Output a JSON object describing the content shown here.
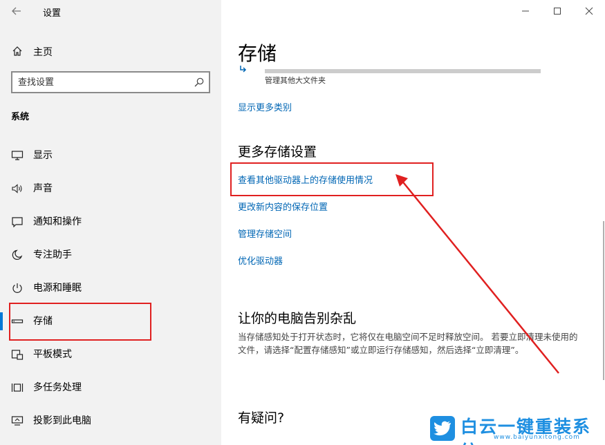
{
  "app": {
    "title": "设置"
  },
  "sidebar": {
    "home_label": "主页",
    "search_placeholder": "查找设置",
    "section_label": "系统",
    "items": [
      {
        "label": "显示",
        "icon": "monitor-icon"
      },
      {
        "label": "声音",
        "icon": "speaker-icon"
      },
      {
        "label": "通知和操作",
        "icon": "notification-icon"
      },
      {
        "label": "专注助手",
        "icon": "moon-icon"
      },
      {
        "label": "电源和睡眠",
        "icon": "power-icon"
      },
      {
        "label": "存储",
        "icon": "storage-icon",
        "selected": true
      },
      {
        "label": "平板模式",
        "icon": "tablet-icon"
      },
      {
        "label": "多任务处理",
        "icon": "multitask-icon"
      },
      {
        "label": "投影到此电脑",
        "icon": "project-icon"
      }
    ]
  },
  "main": {
    "title": "存储",
    "storage_bar_label": "管理其他大文件夹",
    "show_more_link": "显示更多类别",
    "more_settings_heading": "更多存储设置",
    "links": [
      "查看其他驱动器上的存储使用情况",
      "更改新内容的保存位置",
      "管理存储空间",
      "优化驱动器"
    ],
    "declutter_heading": "让你的电脑告别杂乱",
    "declutter_desc": "当存储感知处于打开状态时，它将仅在电脑空间不足时释放空间。 若要立即清理未使用的文件，请选择“配置存储感知”或立即运行存储感知，然后选择“立即清理”。",
    "question_heading": "有疑问?"
  },
  "watermark": {
    "brand": "白云一键重装系统",
    "url": "www.baiyunxitong.com"
  },
  "colors": {
    "accent": "#0078d7",
    "link": "#0066b4",
    "annotation": "#e02020",
    "watermark": "#1e8fe1"
  }
}
